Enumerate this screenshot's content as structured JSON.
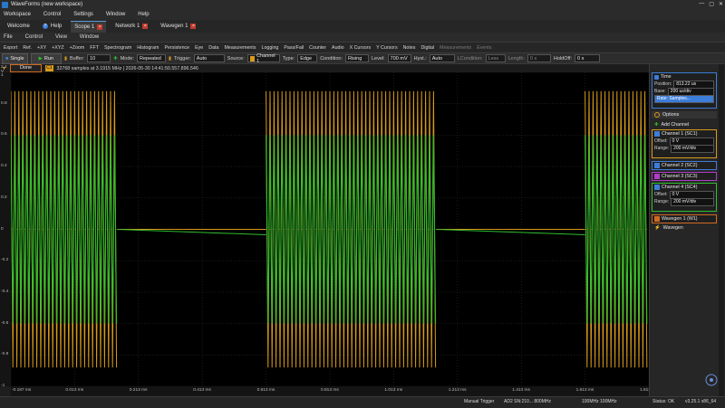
{
  "app": {
    "title": "WaveForms (new workspace)",
    "window_buttons": [
      "—",
      "▢",
      "✕"
    ]
  },
  "menu": [
    "Workspace",
    "Control",
    "Settings",
    "Window",
    "Help"
  ],
  "tabs": [
    {
      "label": "Welcome",
      "closable": false
    },
    {
      "label": "Help",
      "closable": false
    },
    {
      "label": "Scope 1",
      "closable": true,
      "active": true
    },
    {
      "label": "Network 1",
      "closable": true
    },
    {
      "label": "Wavegen 1",
      "closable": true
    }
  ],
  "subbar": [
    "File",
    "Control",
    "View",
    "Window"
  ],
  "tools": [
    {
      "label": "Export",
      "dim": false
    },
    {
      "label": "Ref.",
      "dim": false
    },
    {
      "label": "+XY",
      "dim": false
    },
    {
      "label": "+XYZ",
      "dim": false
    },
    {
      "label": "+Zoom",
      "dim": false
    },
    {
      "label": "FFT",
      "dim": false
    },
    {
      "label": "Spectrogram",
      "dim": false
    },
    {
      "label": "Histogram",
      "dim": false
    },
    {
      "label": "Persistence",
      "dim": false
    },
    {
      "label": "Eye",
      "dim": false
    },
    {
      "label": "Data",
      "dim": false
    },
    {
      "label": "Measurements",
      "dim": false
    },
    {
      "label": "Logging",
      "dim": false
    },
    {
      "label": "Pass/Fail",
      "dim": false
    },
    {
      "label": "Counter",
      "dim": false
    },
    {
      "label": "Audio",
      "dim": false
    },
    {
      "label": "X Cursors",
      "dim": false
    },
    {
      "label": "Y Cursors",
      "dim": false
    },
    {
      "label": "Notes",
      "dim": false
    },
    {
      "label": "Digital",
      "dim": false
    },
    {
      "label": "Measurements",
      "dim": true
    },
    {
      "label": "Events",
      "dim": true
    }
  ],
  "controls": {
    "single": "Single",
    "run": "Run",
    "buffer_label": "Buffer:",
    "buffer_value": "10",
    "mode_label": "Mode:",
    "mode_value": "Repeated",
    "trigger_label": "Trigger:",
    "trigger_value": "Auto",
    "source_label": "Source:",
    "source_value": "Channel 1",
    "type_label": "Type:",
    "type_value": "Edge",
    "condition_label": "Condition:",
    "condition_value": "Rising",
    "level_label": "Level:",
    "level_value": "700 mV",
    "hyst_label": "Hyst.:",
    "hyst_value": "Auto",
    "lcondition_label": "LCondition:",
    "lcondition_value": "Less",
    "length_label": "Length:",
    "length_value": "0 s",
    "holdoff_label": "HoldOff:",
    "holdoff_value": "0 s"
  },
  "info": {
    "status": "Done",
    "channel_tag": "C1",
    "acq_text": "32768 samples at 3.1915 MHz | 2026-05-30 14:41:50.557.896.546"
  },
  "y_axis": {
    "unit": "2.4 V",
    "ticks": [
      "1",
      "0.8",
      "0.6",
      "0.4",
      "0.2",
      "0",
      "-0.2",
      "-0.4",
      "-0.6",
      "-0.8",
      "-1"
    ]
  },
  "x_axis": {
    "ticks": [
      "-0.187 ms",
      "0.013 ms",
      "0.213 ms",
      "0.413 ms",
      "0.613 ms",
      "0.813 ms",
      "1.013 ms",
      "1.213 ms",
      "1.413 ms",
      "1.613 ms",
      "1.813 ms"
    ]
  },
  "chart_data": {
    "type": "line",
    "xlim": [
      -0.187,
      1.813
    ],
    "ylim": [
      -1,
      1
    ],
    "grid": true,
    "series": [
      {
        "name": "Channel 1 (SC1)",
        "color": "#d89b1a",
        "bursts_ms": [
          [
            -0.187,
            0.146
          ],
          [
            0.613,
            1.146
          ],
          [
            1.613,
            1.813
          ]
        ],
        "amplitude_v": 0.88,
        "idle_v": 0.0
      },
      {
        "name": "Channel 2 (SC2)",
        "color": "#2fbf2f",
        "bursts_ms": [
          [
            -0.187,
            0.146
          ],
          [
            0.613,
            1.146
          ],
          [
            1.613,
            1.813
          ]
        ],
        "amplitude_v": 0.6,
        "idle_v": 0.0
      }
    ]
  },
  "panel": {
    "time": {
      "title": "Time",
      "position_label": "Position:",
      "position_value": "813.22 us",
      "base_label": "Base:",
      "base_value": "200 us/div",
      "rate_label": "Rate: Samples..."
    },
    "options": "Options",
    "add_channel": "Add Channel",
    "channels": [
      {
        "title": "Channel 1 (SC1)",
        "color": "#d89b1a",
        "offset": "0 V",
        "range": "200 mV/div",
        "expanded": true
      },
      {
        "title": "Channel 2 (SC2)",
        "color": "#3b7dd8",
        "expanded": false
      },
      {
        "title": "Channel 3 (SC3)",
        "color": "#b03cc8",
        "expanded": false
      },
      {
        "title": "Channel 4 (SC4)",
        "color": "#2fbf2f",
        "offset": "0 V",
        "range": "200 mV/div",
        "expanded": true
      }
    ],
    "offset_label": "Offset:",
    "range_label": "Range:",
    "wavegen": "Wavegen 1 (W1)",
    "wavegen_sub": "Wavegen"
  },
  "statusbar": {
    "manual_trigger": "Manual Trigger",
    "device": "AD2 SN:210... 800MHz",
    "rate": "100MHz 100MHz",
    "status": "Status: OK",
    "version": "v3.25.1 x86_64"
  }
}
